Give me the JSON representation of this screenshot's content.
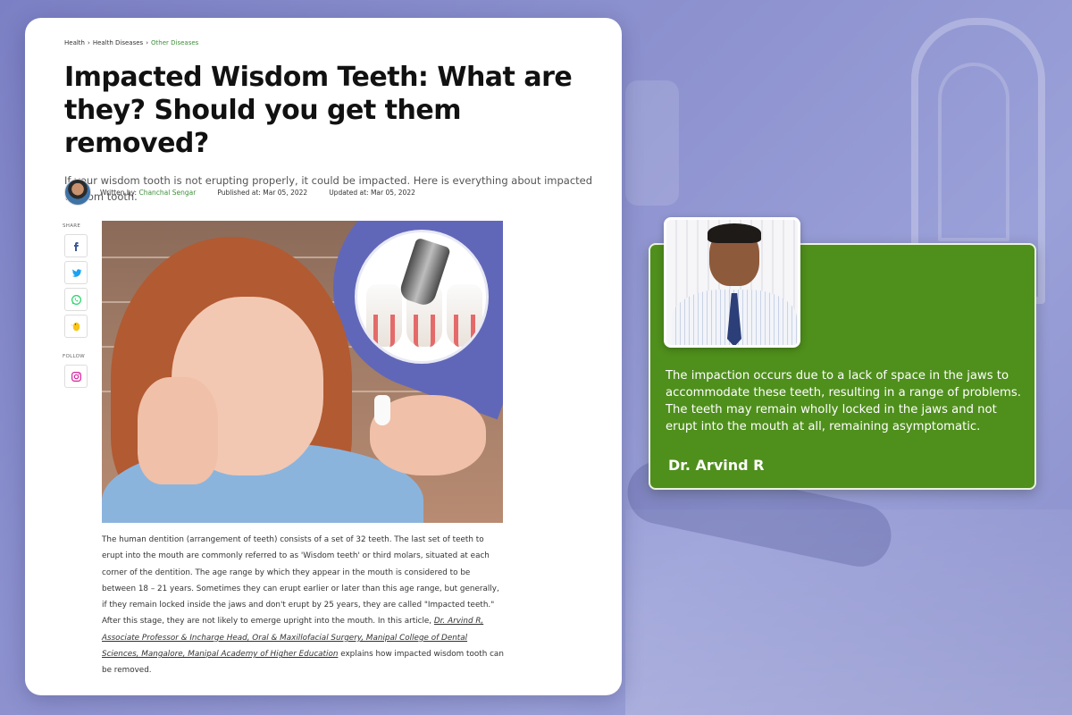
{
  "breadcrumb": [
    "Health",
    "Health Diseases",
    "Other Diseases"
  ],
  "article": {
    "title": "Impacted Wisdom Teeth: What are they? Should you get them removed?",
    "subtitle": "If your wisdom tooth is not erupting properly, it could be impacted. Here is everything about impacted wisdom tooth.",
    "written_by_label": "Written by:",
    "author": "Chanchal Sengar",
    "published": "Published at: Mar 05, 2022",
    "updated": "Updated at: Mar 05, 2022",
    "body_part1": "The human dentition (arrangement of teeth) consists of a set of 32 teeth. The last set of teeth to erupt into the mouth are commonly referred to as 'Wisdom teeth' or third molars, situated at each corner of the dentition. The age range by which they appear in the mouth is considered to be between 18 – 21 years. Sometimes they can erupt earlier or later than this age range, but generally, if they remain locked inside the jaws and don't erupt by 25 years, they are called \"Impacted teeth.\" After this stage, they are not likely to emerge upright into the mouth. In this article, ",
    "body_link": "Dr. Arvind R, Associate Professor & Incharge Head, Oral & Maxillofacial Surgery, Manipal College of Dental Sciences, Mangalore, Manipal Academy of Higher Education",
    "body_part2": " explains how impacted wisdom tooth can be removed."
  },
  "share": {
    "label": "SHARE",
    "follow_label": "FOLLOW",
    "icons": [
      "facebook-icon",
      "twitter-icon",
      "whatsapp-icon",
      "koo-icon",
      "instagram-icon"
    ]
  },
  "quote": {
    "text": "The impaction occurs due to a lack of space in the jaws to accommodate these teeth, resulting in a range of problems. The teeth may remain wholly locked in the jaws and not erupt into the mouth at all, remaining asymptomatic.",
    "author": "Dr. Arvind R"
  },
  "colors": {
    "background": "#8a8fcc",
    "quote_card": "#4f8f1c",
    "link_green": "#3d8f3a"
  }
}
